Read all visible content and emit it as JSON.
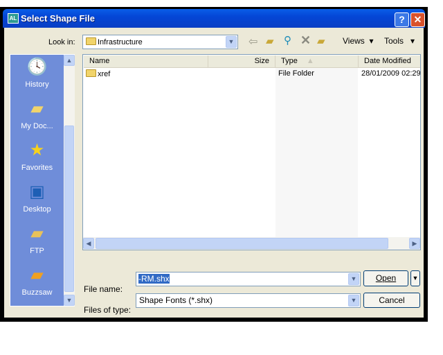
{
  "window": {
    "title": "Select Shape File",
    "help_icon": "?",
    "close_icon": "✕"
  },
  "lookin": {
    "label": "Look in:",
    "value": "Infrastructure"
  },
  "toolbar": {
    "back": "back-icon",
    "up": "up-folder-icon",
    "search": "search-web-icon",
    "delete": "delete-icon",
    "new_folder": "new-folder-icon",
    "views": "Views",
    "tools": "Tools"
  },
  "places": [
    {
      "label": "History"
    },
    {
      "label": "My Doc..."
    },
    {
      "label": "Favorites"
    },
    {
      "label": "Desktop"
    },
    {
      "label": "FTP"
    },
    {
      "label": "Buzzsaw"
    }
  ],
  "columns": [
    "Name",
    "Size",
    "Type",
    "Date Modified"
  ],
  "files": [
    {
      "name": "xref",
      "size": "",
      "type": "File Folder",
      "date": "28/01/2009 02:29"
    }
  ],
  "filename": {
    "label": "File name:",
    "value": "-RM.shx"
  },
  "filetype": {
    "label": "Files of type:",
    "value": "Shape Fonts (*.shx)"
  },
  "buttons": {
    "open": "Open",
    "cancel": "Cancel"
  }
}
